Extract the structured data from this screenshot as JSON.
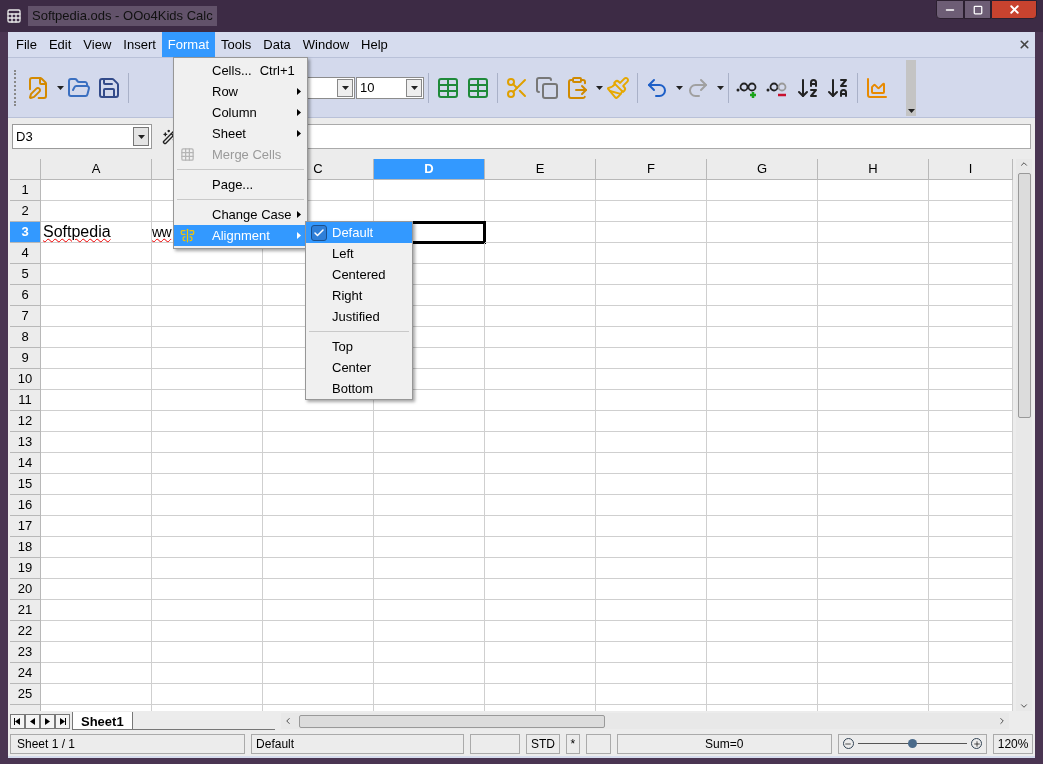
{
  "window": {
    "title": "Softpedia.ods - OOo4Kids Calc"
  },
  "menu_bar": [
    {
      "label": "File",
      "selected": false
    },
    {
      "label": "Edit",
      "selected": false
    },
    {
      "label": "View",
      "selected": false
    },
    {
      "label": "Insert",
      "selected": false
    },
    {
      "label": "Format",
      "selected": true
    },
    {
      "label": "Tools",
      "selected": false
    },
    {
      "label": "Data",
      "selected": false
    },
    {
      "label": "Window",
      "selected": false
    },
    {
      "label": "Help",
      "selected": false
    }
  ],
  "toolbar": {
    "font_size": "10"
  },
  "formula_bar": {
    "name_box": "D3"
  },
  "format_menu": [
    {
      "kind": "item",
      "label": "Cells...",
      "shortcut": "Ctrl+1",
      "submenu": false,
      "disabled": false,
      "highlighted": false
    },
    {
      "kind": "item",
      "label": "Row",
      "submenu": true,
      "disabled": false,
      "highlighted": false
    },
    {
      "kind": "item",
      "label": "Column",
      "submenu": true,
      "disabled": false,
      "highlighted": false
    },
    {
      "kind": "item",
      "label": "Sheet",
      "submenu": true,
      "disabled": false,
      "highlighted": false
    },
    {
      "kind": "item",
      "label": "Merge Cells",
      "submenu": false,
      "disabled": true,
      "highlighted": false
    },
    {
      "kind": "separator"
    },
    {
      "kind": "item",
      "label": "Page...",
      "submenu": false,
      "disabled": false,
      "highlighted": false
    },
    {
      "kind": "separator"
    },
    {
      "kind": "item",
      "label": "Change Case",
      "submenu": true,
      "disabled": false,
      "highlighted": false
    },
    {
      "kind": "item",
      "label": "Alignment",
      "submenu": true,
      "disabled": false,
      "highlighted": true
    }
  ],
  "alignment_menu": [
    {
      "kind": "item",
      "label": "Default",
      "checked": true,
      "highlighted": true
    },
    {
      "kind": "item",
      "label": "Left",
      "checked": false,
      "highlighted": false
    },
    {
      "kind": "item",
      "label": "Centered",
      "checked": false,
      "highlighted": false
    },
    {
      "kind": "item",
      "label": "Right",
      "checked": false,
      "highlighted": false
    },
    {
      "kind": "item",
      "label": "Justified",
      "checked": false,
      "highlighted": false
    },
    {
      "kind": "separator"
    },
    {
      "kind": "item",
      "label": "Top",
      "checked": false,
      "highlighted": false
    },
    {
      "kind": "item",
      "label": "Center",
      "checked": false,
      "highlighted": false
    },
    {
      "kind": "item",
      "label": "Bottom",
      "checked": false,
      "highlighted": false
    }
  ],
  "sheet": {
    "columns": [
      {
        "label": "A",
        "selected": false
      },
      {
        "selected": false
      },
      {
        "label": "C",
        "selected": false
      },
      {
        "label": "D",
        "selected": true
      },
      {
        "label": "E",
        "selected": false
      },
      {
        "label": "F",
        "selected": false
      },
      {
        "label": "G",
        "selected": false
      },
      {
        "label": "H",
        "selected": false
      },
      {
        "label": "I",
        "selected": false
      }
    ],
    "rows": [
      {
        "label": "1",
        "selected": false
      },
      {
        "label": "2",
        "selected": false
      },
      {
        "label": "3",
        "selected": true,
        "cells": [
          {
            "text": "Softpedia",
            "misspelled": true
          },
          {
            "text": "ww",
            "misspelled": true
          }
        ]
      },
      {
        "label": "4",
        "selected": false
      },
      {
        "label": "5",
        "selected": false
      },
      {
        "label": "6",
        "selected": false
      },
      {
        "label": "7",
        "selected": false
      },
      {
        "label": "8",
        "selected": false
      },
      {
        "label": "9",
        "selected": false
      },
      {
        "label": "10",
        "selected": false
      },
      {
        "label": "11",
        "selected": false
      },
      {
        "label": "12",
        "selected": false
      },
      {
        "label": "13",
        "selected": false
      },
      {
        "label": "14",
        "selected": false
      },
      {
        "label": "15",
        "selected": false
      },
      {
        "label": "16",
        "selected": false
      },
      {
        "label": "17",
        "selected": false
      },
      {
        "label": "18",
        "selected": false
      },
      {
        "label": "19",
        "selected": false
      },
      {
        "label": "20",
        "selected": false
      },
      {
        "label": "21",
        "selected": false
      },
      {
        "label": "22",
        "selected": false
      },
      {
        "label": "23",
        "selected": false
      },
      {
        "label": "24",
        "selected": false
      },
      {
        "label": "25",
        "selected": false
      }
    ]
  },
  "sheet_tabs": [
    {
      "label": "Sheet1",
      "selected": true
    }
  ],
  "status_bar": {
    "sheet": "Sheet 1 / 1",
    "page_style": "Default",
    "mode": "STD",
    "modified": "*",
    "sum": "Sum=0",
    "zoom": {
      "level": 0.5
    },
    "zoom_reading": "120%"
  }
}
